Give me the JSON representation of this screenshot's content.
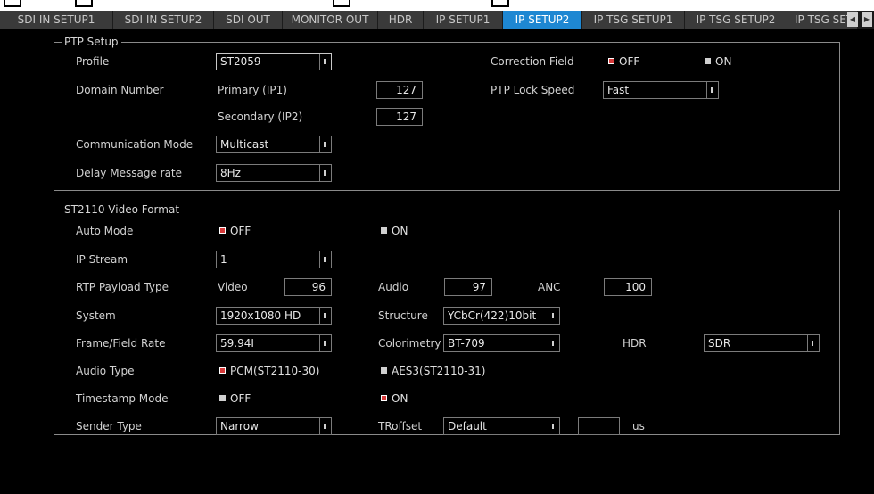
{
  "tabs": [
    {
      "label": "SDI IN SETUP1",
      "active": false
    },
    {
      "label": "SDI IN SETUP2",
      "active": false
    },
    {
      "label": "SDI OUT",
      "active": false
    },
    {
      "label": "MONITOR OUT",
      "active": false
    },
    {
      "label": "HDR",
      "active": false
    },
    {
      "label": "IP SETUP1",
      "active": false
    },
    {
      "label": "IP SETUP2",
      "active": true
    },
    {
      "label": "IP TSG SETUP1",
      "active": false
    },
    {
      "label": "IP TSG SETUP2",
      "active": false
    },
    {
      "label": "IP TSG SET",
      "active": false
    }
  ],
  "colors": {
    "active_tab": "#1e87d2",
    "selected_radio": "#d63a3a",
    "unselected_radio": "#d0d0d0"
  },
  "ptp": {
    "legend": "PTP Setup",
    "profile_label": "Profile",
    "profile_value": "ST2059",
    "domain_label": "Domain Number",
    "primary_label": "Primary (IP1)",
    "primary_value": "127",
    "secondary_label": "Secondary (IP2)",
    "secondary_value": "127",
    "comm_label": "Communication Mode",
    "comm_value": "Multicast",
    "delay_label": "Delay Message rate",
    "delay_value": "8Hz",
    "correction_label": "Correction Field",
    "correction_off": "OFF",
    "correction_on": "ON",
    "correction_selected": "OFF",
    "lock_label": "PTP Lock Speed",
    "lock_value": "Fast"
  },
  "video": {
    "legend": "ST2110 Video Format",
    "auto_label": "Auto Mode",
    "auto_off": "OFF",
    "auto_on": "ON",
    "auto_selected": "OFF",
    "stream_label": "IP Stream",
    "stream_value": "1",
    "rtp_label": "RTP Payload Type",
    "rtp_video_label": "Video",
    "rtp_video_value": "96",
    "rtp_audio_label": "Audio",
    "rtp_audio_value": "97",
    "rtp_anc_label": "ANC",
    "rtp_anc_value": "100",
    "system_label": "System",
    "system_value": "1920x1080 HD",
    "structure_label": "Structure",
    "structure_value": "YCbCr(422)10bit",
    "frame_label": "Frame/Field Rate",
    "frame_value": "59.94I",
    "colorimetry_label": "Colorimetry",
    "colorimetry_value": "BT-709",
    "hdr_label": "HDR",
    "hdr_value": "SDR",
    "audio_type_label": "Audio Type",
    "audio_pcm": "PCM(ST2110-30)",
    "audio_aes": "AES3(ST2110-31)",
    "audio_selected": "PCM",
    "timestamp_label": "Timestamp Mode",
    "timestamp_off": "OFF",
    "timestamp_on": "ON",
    "timestamp_selected": "ON",
    "sender_label": "Sender Type",
    "sender_value": "Narrow",
    "troffset_label": "TRoffset",
    "troffset_value": "Default",
    "troffset_us_value": "",
    "troffset_unit": "us"
  }
}
